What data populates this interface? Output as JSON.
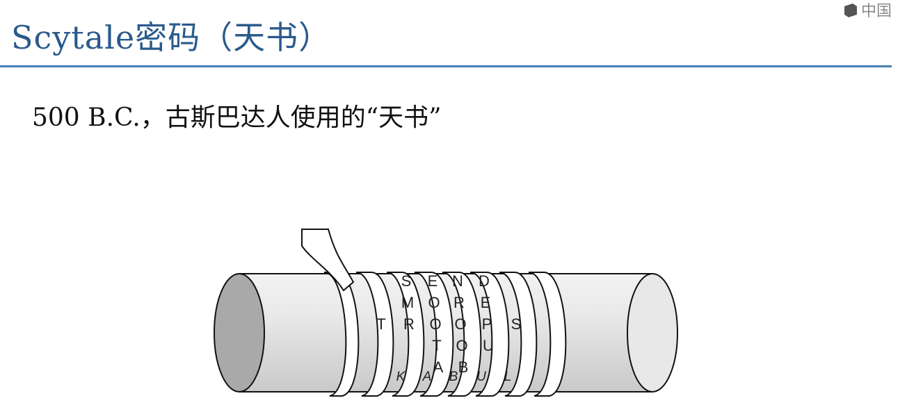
{
  "slide": {
    "title": "Scytale密码（天书）",
    "subtitle": "500 B.C.，古斯巴达人使用的“天书”",
    "logo_text": "中国"
  },
  "figure": {
    "columns": [
      {
        "letters": [
          "T"
        ]
      },
      {
        "letters": [
          "S",
          "M",
          "R"
        ]
      },
      {
        "letters": [
          "E",
          "O",
          "O",
          "T",
          "A"
        ]
      },
      {
        "letters": [
          "N",
          "R",
          "O",
          "O",
          "B"
        ]
      },
      {
        "letters": [
          "D",
          "E",
          "P",
          "U"
        ]
      },
      {
        "letters": [
          "S"
        ]
      }
    ],
    "bottom_letters": [
      "K",
      "A",
      "B",
      "U",
      "L"
    ]
  }
}
